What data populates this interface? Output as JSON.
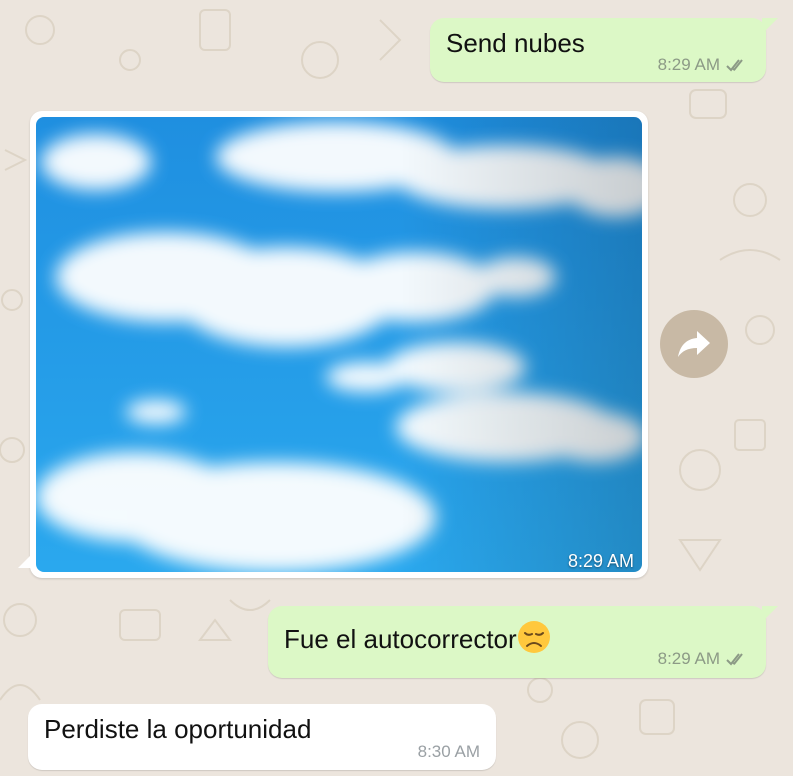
{
  "chat": {
    "messages": [
      {
        "direction": "outgoing",
        "text": "Send nubes",
        "time": "8:29 AM",
        "status": "read-double-tick"
      },
      {
        "direction": "incoming",
        "type": "image",
        "image_description": "blue sky with white clouds",
        "time": "8:29 AM"
      },
      {
        "direction": "outgoing",
        "text": "Fue el autocorrector",
        "emoji": "disappointed-face",
        "time": "8:29 AM",
        "status": "read-double-tick"
      },
      {
        "direction": "incoming",
        "text": "Perdiste la oportunidad",
        "time": "8:30 AM"
      }
    ],
    "forward_icon": "forward-arrow-icon"
  },
  "colors": {
    "background": "#ece5dd",
    "outgoing_bubble": "#dcf8c6",
    "incoming_bubble": "#ffffff",
    "forward_button": "#c8b9a5",
    "sky_blue": "#1e9ee6"
  }
}
